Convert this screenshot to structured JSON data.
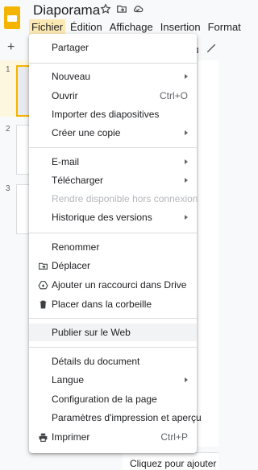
{
  "doc": {
    "title": "Diaporama"
  },
  "menubar": [
    "Fichier",
    "Édition",
    "Affichage",
    "Insertion",
    "Format"
  ],
  "toolbar": {
    "add": "+"
  },
  "slides": [
    "1",
    "2",
    "3"
  ],
  "notes_placeholder": "Cliquez pour ajouter le",
  "menu": {
    "share": "Partager",
    "new": "Nouveau",
    "open": "Ouvrir",
    "open_shortcut": "Ctrl+O",
    "import_slides": "Importer des diapositives",
    "make_copy": "Créer une copie",
    "email": "E-mail",
    "download": "Télécharger",
    "offline": "Rendre disponible hors connexion",
    "version_history": "Historique des versions",
    "rename": "Renommer",
    "move": "Déplacer",
    "add_shortcut": "Ajouter un raccourci dans Drive",
    "trash": "Placer dans la corbeille",
    "publish": "Publier sur le Web",
    "details": "Détails du document",
    "language": "Langue",
    "page_setup": "Configuration de la page",
    "print_settings": "Paramètres d'impression et aperçu",
    "print": "Imprimer",
    "print_shortcut": "Ctrl+P"
  },
  "colors": {
    "accent": "#f4b400",
    "menu_active": "#fce8b2",
    "hover": "#f1f3f4"
  }
}
